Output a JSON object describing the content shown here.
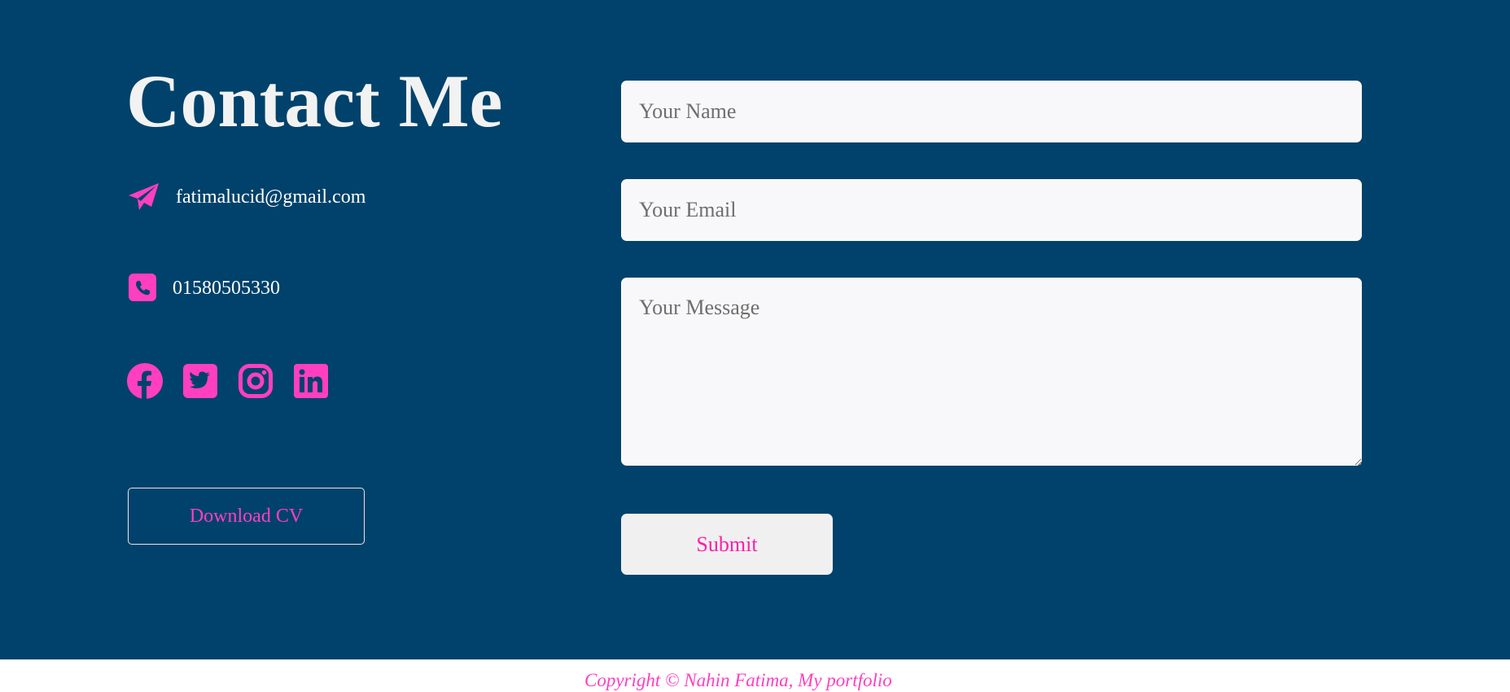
{
  "contact": {
    "heading": "Contact Me",
    "email": "fatimalucid@gmail.com",
    "phone": "01580505330",
    "download_cv_label": "Download CV",
    "socials": [
      "facebook-icon",
      "twitter-icon",
      "instagram-icon",
      "linkedin-icon"
    ]
  },
  "form": {
    "name_placeholder": "Your Name",
    "email_placeholder": "Your Email",
    "message_placeholder": "Your Message",
    "submit_label": "Submit"
  },
  "footer": {
    "copyright": "Copyright © Nahin Fatima, My portfolio"
  },
  "colors": {
    "background": "#00426b",
    "accent": "#ff3fbf",
    "field_bg": "#f8f8fa"
  }
}
